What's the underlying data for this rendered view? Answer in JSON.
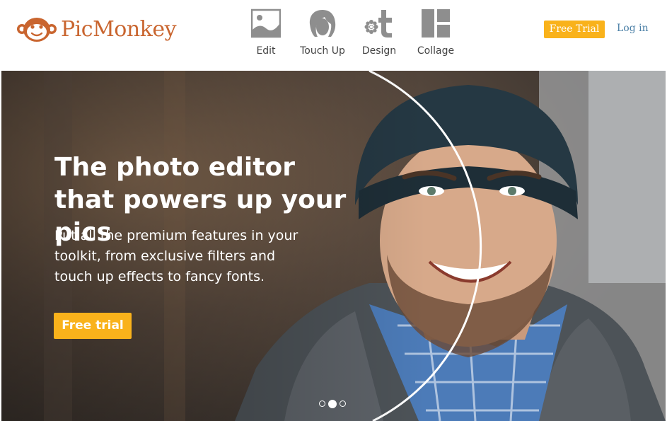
{
  "brand": {
    "name": "PicMonkey",
    "color": "#c9652f"
  },
  "nav": {
    "items": [
      {
        "label": "Edit",
        "icon": "image-icon"
      },
      {
        "label": "Touch Up",
        "icon": "face-icon"
      },
      {
        "label": "Design",
        "icon": "design-icon"
      },
      {
        "label": "Collage",
        "icon": "collage-icon"
      }
    ]
  },
  "header": {
    "free_trial_label": "Free Trial",
    "login_label": "Log in"
  },
  "hero": {
    "title": "The photo editor that powers up your pics",
    "subtitle": "Put all the premium features in your toolkit, from exclusive filters and touch up effects to fancy fonts.",
    "cta_label": "Free trial",
    "carousel": {
      "slides": 3,
      "active_index": 1
    }
  },
  "colors": {
    "accent": "#f9b21b",
    "link": "#4a7fa6",
    "nav_icon": "#8e8e8e"
  }
}
